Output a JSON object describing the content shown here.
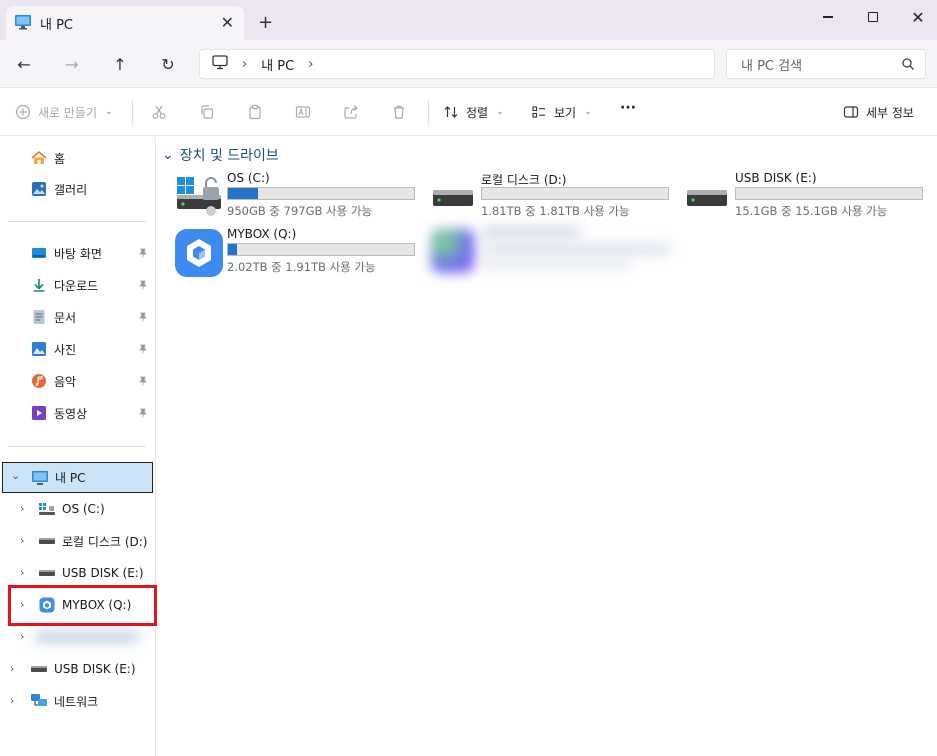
{
  "window": {
    "tab_title": "내 PC",
    "close_glyph": "✕",
    "new_tab_glyph": "+",
    "close_window_glyph": "✕"
  },
  "navbar": {
    "back_glyph": "←",
    "forward_glyph": "→",
    "up_glyph": "↑",
    "refresh_glyph": "↻",
    "address_separator": "›",
    "address_location": "내 PC",
    "search_placeholder": "내 PC 검색"
  },
  "toolbar": {
    "new_label": "새로 만들기",
    "sort_label": "정렬",
    "view_label": "보기",
    "more_label": "···",
    "details_label": "세부 정보",
    "dropdown_glyph": "⌄"
  },
  "sidebar": {
    "quick": [
      {
        "label": "홈",
        "icon": "home-icon"
      },
      {
        "label": "갤러리",
        "icon": "gallery-icon"
      }
    ],
    "pinned": [
      {
        "label": "바탕 화면",
        "icon": "desktop-icon"
      },
      {
        "label": "다운로드",
        "icon": "download-icon"
      },
      {
        "label": "문서",
        "icon": "documents-icon"
      },
      {
        "label": "사진",
        "icon": "pictures-icon"
      },
      {
        "label": "음악",
        "icon": "music-icon"
      },
      {
        "label": "동영상",
        "icon": "videos-icon"
      }
    ],
    "tree": {
      "pc_label": "내 PC",
      "children": [
        "OS (C:)",
        "로컬 디스크 (D:)",
        "USB DISK (E:)",
        "MYBOX (Q:)"
      ],
      "usb_root": "USB DISK (E:)",
      "network": "네트워크"
    },
    "expand_glyph": "›",
    "collapse_glyph": "⌄"
  },
  "main": {
    "section_title": "장치 및 드라이브",
    "section_chevron": "⌄",
    "drives": [
      {
        "name": "OS (C:)",
        "info": "950GB 중 797GB 사용 가능",
        "used_fraction": 0.16,
        "icon": "windows-drive-icon"
      },
      {
        "name": "로컬 디스크 (D:)",
        "info": "1.81TB 중 1.81TB 사용 가능",
        "used_fraction": 0.0,
        "icon": "hard-drive-icon"
      },
      {
        "name": "USB DISK (E:)",
        "info": "15.1GB 중 15.1GB 사용 가능",
        "used_fraction": 0.0,
        "icon": "usb-drive-icon"
      },
      {
        "name": "MYBOX (Q:)",
        "info": "2.02TB 중 1.91TB 사용 가능",
        "used_fraction": 0.05,
        "icon": "mybox-icon"
      }
    ]
  },
  "colors": {
    "accent": "#2572c9",
    "highlight": "#e8111c",
    "selection": "#cce4f7",
    "section_head": "#1a4e8a"
  }
}
